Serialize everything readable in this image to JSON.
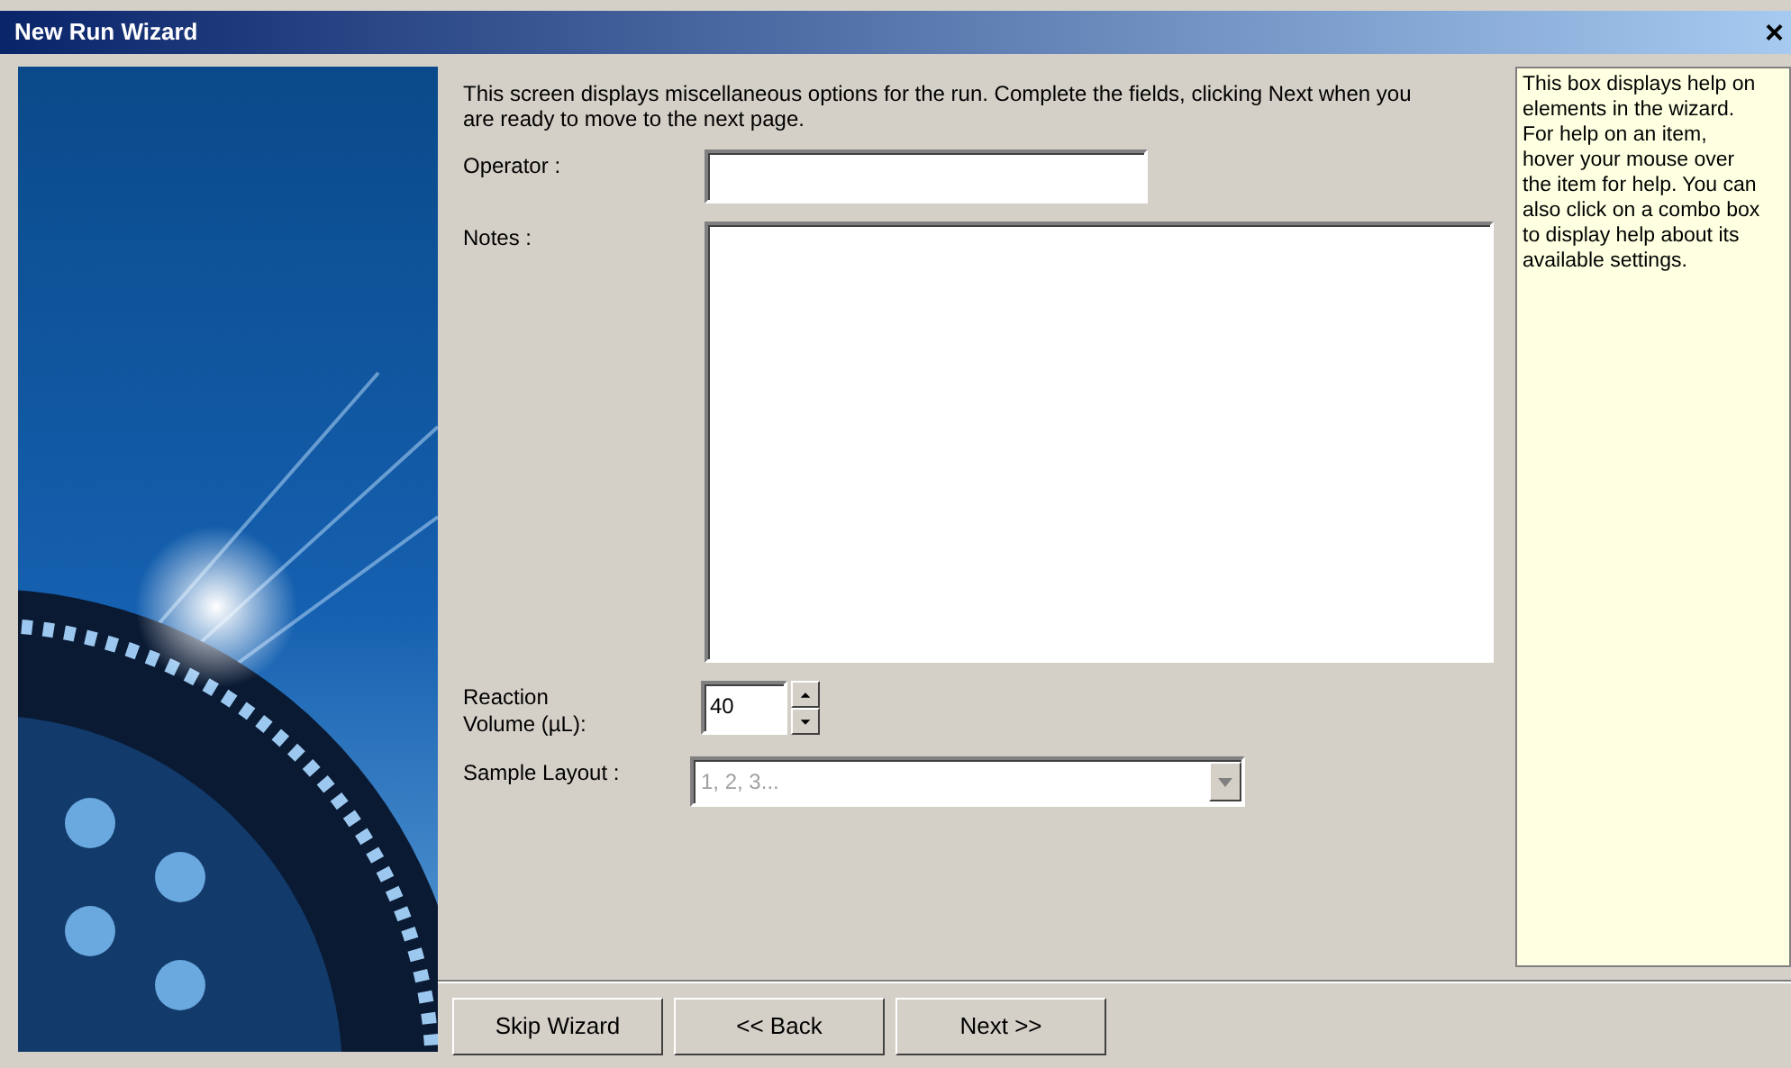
{
  "window": {
    "title": "New Run Wizard",
    "close": "×"
  },
  "intro": "This screen displays miscellaneous options for the run. Complete the fields, clicking Next when you are ready to move to the next page.",
  "fields": [
    {
      "kind": "text",
      "label": "Operator :"
    },
    {
      "kind": "textarea",
      "label": "Notes :"
    },
    {
      "kind": "spinner",
      "label": "Reaction Volume (µL):",
      "value": "40"
    },
    {
      "kind": "combo",
      "label": "Sample Layout :",
      "value": "1, 2, 3...",
      "disabled": true
    }
  ],
  "help": "This box displays help on elements in the wizard. For help on an item, hover your mouse over the item for help. You can also click on a combo box to display help about its available settings.",
  "buttons": [
    {
      "label": "Skip Wizard"
    },
    {
      "label": "<< Back"
    },
    {
      "label": "Next >>"
    }
  ]
}
